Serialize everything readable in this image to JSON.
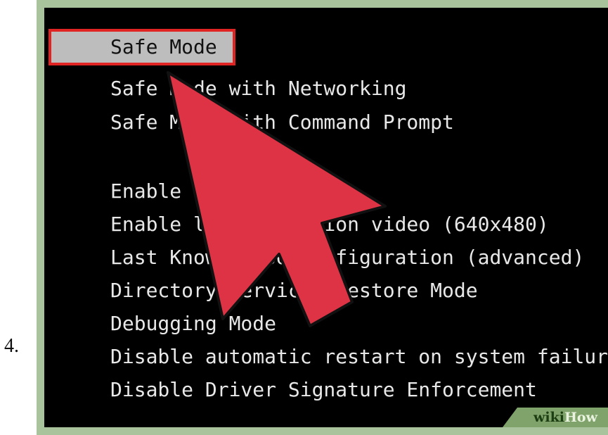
{
  "step": {
    "number": "4."
  },
  "boot_menu": {
    "items": [
      {
        "label": "Safe Mode",
        "selected": true
      },
      {
        "label": "Safe Mode with Networking"
      },
      {
        "label": "Safe Mode with Command Prompt"
      },
      {
        "label": "Enable Boot Logging"
      },
      {
        "label": "Enable low-resolution video (640x480)"
      },
      {
        "label": "Last Known Good Configuration (advanced)"
      },
      {
        "label": "Directory Services Restore Mode"
      },
      {
        "label": "Debugging Mode"
      },
      {
        "label": "Disable automatic restart on system failure"
      },
      {
        "label": "Disable Driver Signature Enforcement"
      }
    ]
  },
  "colors": {
    "screen_background": "#000000",
    "menu_text": "#e8e8e8",
    "selected_highlight": "#bdbdbd",
    "selection_border": "#e02424",
    "arrow_fill": "#de3344",
    "frame": "#a9c49d"
  },
  "watermark": {
    "wiki": "wiki",
    "how": "How"
  },
  "icons": {
    "pointer": "pointer-arrow-icon"
  }
}
